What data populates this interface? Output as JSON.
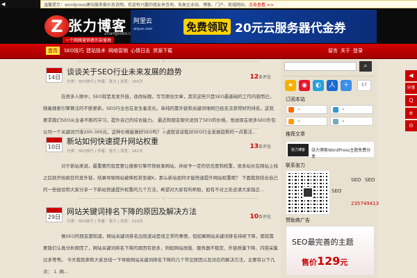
{
  "notice": {
    "icon": "notice-icon",
    "prefix": "温馨提示：",
    "text": "wordpress建站服务报价及说明，欢迎有兴趣的朋友来咨询，各类企业站、博客、门户、商城网站，",
    "link": "点击查看 >>"
  },
  "logo": {
    "mark": "Z",
    "name": "张力博客",
    "url": "Zhangliseo.com",
    "slogan": "一个网络营销者的自留地"
  },
  "ad": {
    "brand": "阿里云",
    "brand_url": "aliyun.com",
    "cta": "免费领取",
    "headline": "20元云服务器代金券"
  },
  "nav": {
    "items": [
      "首页",
      "SEO技巧",
      "建站技术",
      "网络营销",
      "心情日志",
      "资源下载"
    ],
    "right": [
      "留言",
      "关于",
      "登录"
    ]
  },
  "posts": [
    {
      "day": "14日",
      "title": "谈谈关于SEO行业未来发展的趋势",
      "meta": "分类：SEO技巧 | 作者：张力 | 浏览：166次",
      "count": "12",
      "count_unit": "条评论",
      "excerpt": "在很多人眼中，SEO就是发发外链，改改标题，写写原创文章，其实这些只是SEO最基础的工作内容而已，随着搜索引擎算法的不断更新，SEO行业也在发生着变化，单纯的靠外链和关键词堆砌已经无法获得好的排名，这就要求我们SEO从业者不断的学习，提升自己的综合能力。 最近和朋友聊天说到了SEO的价格，他说现在很多SEO外包公司一个关键词只收200-300元，这种价格能做好SEO吗？下面就谈谈我对SEO行业发展趋势的一点看法..."
    },
    {
      "day": "10日",
      "title": "新站如何快速提升网站权重",
      "meta": "分类：SEO技巧 | 作者：张力 | 浏览：182次",
      "count": "13",
      "count_unit": "条评论",
      "excerpt": "对于新站来说，最重要的就是要让搜索引擎尽快收录网站，并给予一定的信任度和权重，很多站长在网站上线之后就开始疯狂的发外链，结果导致网站被降权甚至被K，那么新站如何才能快速提升网站权重呢？ 下面我就结合自己的一些经验和大家分享一下新站快速提升权重的几个方法，希望对大家有所帮助，如有不对之处还请大家指正..."
    },
    {
      "day": "29日",
      "title": "网站关键词排名下降的原因及解决方法",
      "meta": "分类：SEO技巧 | 作者：张力 | 浏览：210次",
      "count": "10",
      "count_unit": "条评论",
      "excerpt": "做SEO的朋友都知道，网站关键词排名出现波动是很正常的事情，但如果网站关键词排名持续下降，那就需要我们认真分析原因了，网站关键词排名下降的原因有很多，例如网站改版、服务器不稳定、外链质量下降、内容采集过多等等。 今天我就来和大家总结一下导致网站关键词排名下降的几个常见原因以及对应的解决方法，主要有以下几点： 1. 网..."
    }
  ],
  "sidebar": {
    "search_placeholder": "",
    "search_icon": "search-icon",
    "social_count": "57",
    "subscribe_title": "订阅本站",
    "subscribe": [
      "»",
      "»",
      "»",
      "»"
    ],
    "recommend_title": "推荐文章",
    "recommend_thumb": "张力博客",
    "recommend_text": "张力博客WordPress主题免费分享",
    "contact_title": "联系张力",
    "contact_labels": [
      "SEO",
      "SEO",
      "SEO",
      "235749413"
    ],
    "promo_title": "赞助商广告",
    "promo_line1": "SEO最完善的主题",
    "promo_price_prefix": "售价",
    "promo_price": "129",
    "promo_price_suffix": "元"
  },
  "float_bar": [
    "◀",
    "分享",
    "Q",
    "e",
    "⊙"
  ],
  "colors": {
    "brand_red": "#cc0000",
    "nav_active": "#ffde3a",
    "bg": "#ece5d6"
  }
}
